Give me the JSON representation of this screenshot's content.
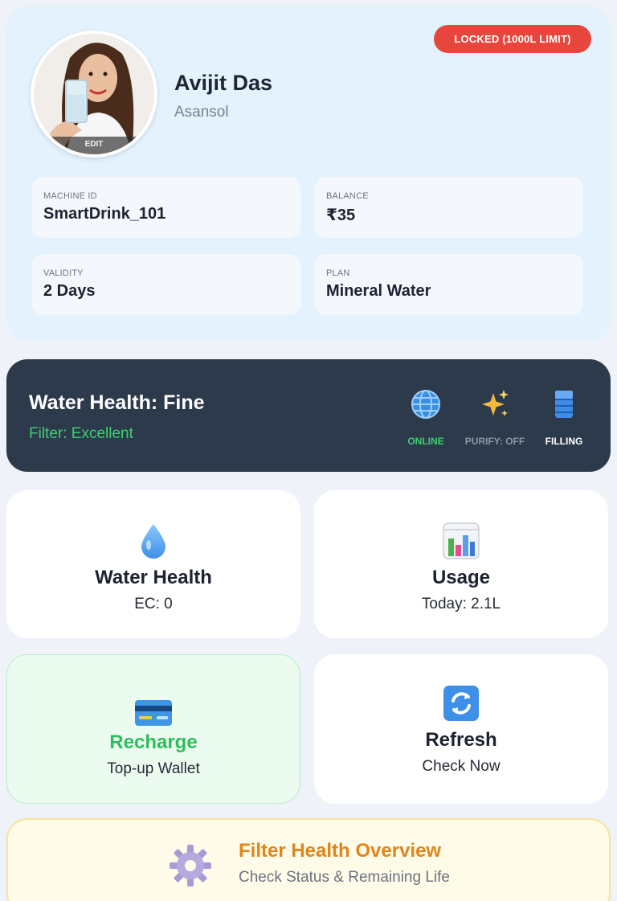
{
  "profile": {
    "name": "Avijit Das",
    "city": "Asansol",
    "avatar_edit": "EDIT",
    "lock_badge": "LOCKED (1000L LIMIT)",
    "info": [
      {
        "label": "MACHINE ID",
        "value": "SmartDrink_101"
      },
      {
        "label": "BALANCE",
        "value": "₹35"
      },
      {
        "label": "VALIDITY",
        "value": "2 Days"
      },
      {
        "label": "PLAN",
        "value": "Mineral Water"
      }
    ]
  },
  "status": {
    "title": "Water Health: Fine",
    "filter": "Filter: Excellent",
    "indicators": [
      {
        "icon": "globe-icon",
        "label": "ONLINE",
        "color": "#3ecf6f"
      },
      {
        "icon": "sparkles-icon",
        "label": "PURIFY: OFF",
        "color": "#8c96a4"
      },
      {
        "icon": "filling-icon",
        "label": "FILLING",
        "color": "#ffffff"
      }
    ]
  },
  "tiles": {
    "water_health": {
      "icon": "droplet-icon",
      "title": "Water Health",
      "sub": "EC: 0"
    },
    "usage": {
      "icon": "bar-chart-icon",
      "title": "Usage",
      "sub": "Today: 2.1L"
    },
    "recharge": {
      "icon": "credit-card-icon",
      "title": "Recharge",
      "sub": "Top-up Wallet"
    },
    "refresh": {
      "icon": "refresh-icon",
      "title": "Refresh",
      "sub": "Check Now"
    }
  },
  "filter_overview": {
    "icon": "gear-icon",
    "title": "Filter Health Overview",
    "sub": "Check Status & Remaining Life"
  },
  "colors": {
    "profile_bg": "#e3f2fd",
    "banner_bg": "#2d3a4c",
    "accent_green": "#3ecf6f",
    "lock_red": "#e8453c",
    "filter_orange": "#e0851a"
  }
}
